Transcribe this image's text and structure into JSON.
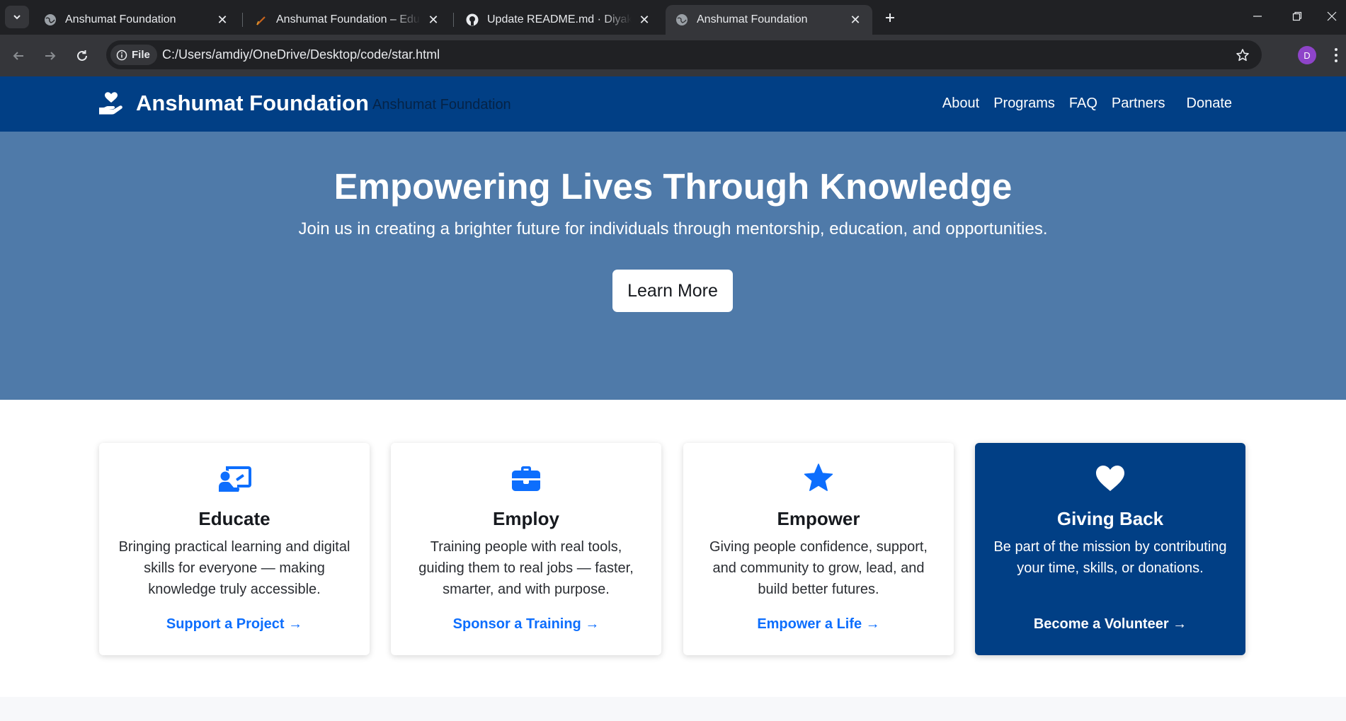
{
  "browser": {
    "tabs": [
      {
        "title": "Anshumat Foundation",
        "active": false
      },
      {
        "title": "Anshumat Foundation – Educat",
        "active": false
      },
      {
        "title": "Update README.md · Diyakshir",
        "active": false
      },
      {
        "title": "Anshumat Foundation",
        "active": true
      }
    ],
    "file_chip": "File",
    "url": "C:/Users/amdiy/OneDrive/Desktop/code/star.html",
    "profile_initial": "D"
  },
  "site": {
    "brand": "Anshumat Foundation",
    "brand_secondary": "Anshumat Foundation",
    "nav": [
      "About",
      "Programs",
      "FAQ",
      "Partners"
    ],
    "donate": "Donate",
    "colors": {
      "nav_bg": "#013f85",
      "hero_bg": "#4f7aa9",
      "accent": "#0d6efd"
    }
  },
  "hero": {
    "title": "Empowering Lives Through Knowledge",
    "subtitle": "Join us in creating a brighter future for individuals through mentorship, education, and opportunities.",
    "button": "Learn More"
  },
  "cards": [
    {
      "icon": "person-chalkboard-icon",
      "title": "Educate",
      "text": "Bringing practical learning and digital skills for everyone — making knowledge truly accessible.",
      "link": "Support a Project →"
    },
    {
      "icon": "briefcase-icon",
      "title": "Employ",
      "text": "Training people with real tools, guiding them to real jobs — faster, smarter, and with purpose.",
      "link": "Sponsor a Training →"
    },
    {
      "icon": "star-icon",
      "title": "Empower",
      "text": "Giving people confidence, support, and community to grow, lead, and build better futures.",
      "link": "Empower a Life →"
    },
    {
      "icon": "heart-icon",
      "title": "Giving Back",
      "text": "Be part of the mission by contributing your time, skills, or donations.",
      "link": "Become a Volunteer →"
    }
  ]
}
